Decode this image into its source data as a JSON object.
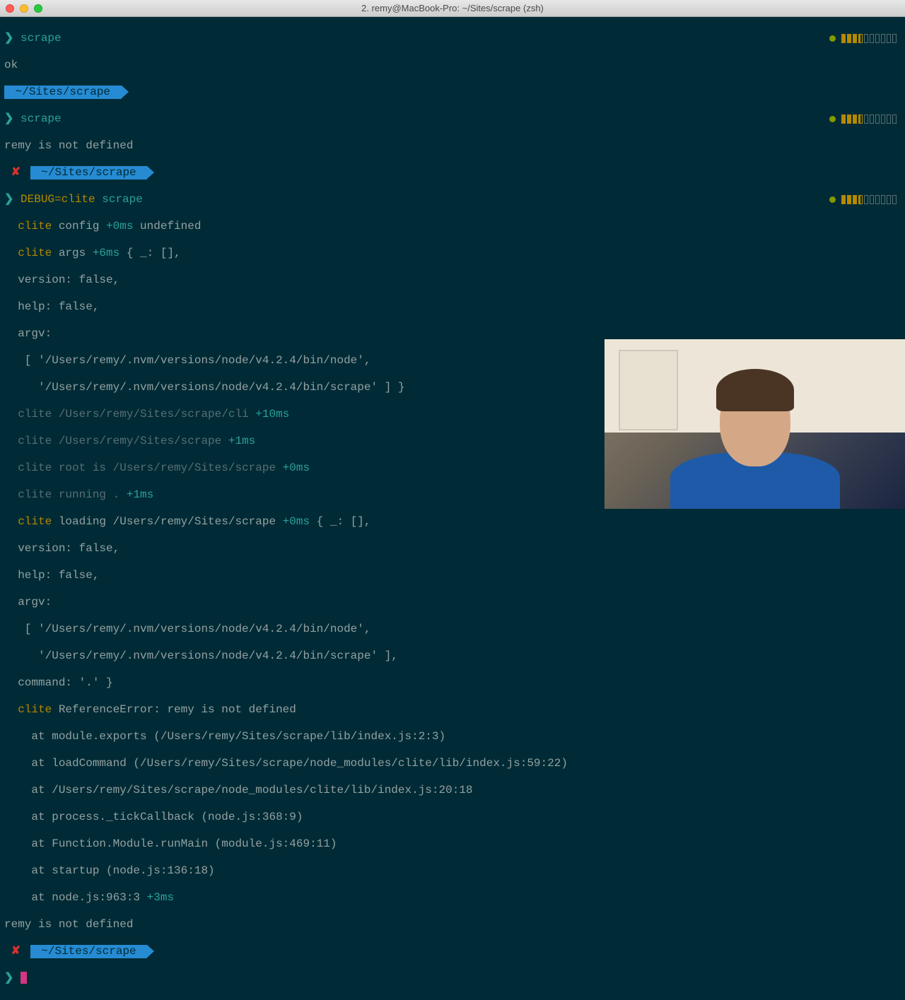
{
  "window": {
    "title": "2. remy@MacBook-Pro: ~/Sites/scrape (zsh)"
  },
  "path": "~/Sites/scrape",
  "prompt_sym": "❯",
  "err_mark": "✘",
  "cmds": {
    "c1": "scrape",
    "ok": "ok",
    "c2": "scrape",
    "err_undef": "remy is not defined",
    "c3_pre": "DEBUG=clite ",
    "c3_cmd": "scrape"
  },
  "debug": {
    "l01a": "clite",
    "l01b": " config ",
    "l01t": "+0ms",
    "l01c": " undefined",
    "l02a": "clite",
    "l02b": " args ",
    "l02t": "+6ms",
    "l02c": " { _: [],",
    "l03": "  version: false,",
    "l04": "  help: false,",
    "l05": "  argv:",
    "l06": "   [ '/Users/remy/.nvm/versions/node/v4.2.4/bin/node',",
    "l07": "     '/Users/remy/.nvm/versions/node/v4.2.4/bin/scrape' ] }",
    "l08a": "clite",
    "l08b": " /Users/remy/Sites/scrape/cli ",
    "l08t": "+10ms",
    "l09a": "clite",
    "l09b": " /Users/remy/Sites/scrape ",
    "l09t": "+1ms",
    "l10a": "clite",
    "l10b": " root is /Users/remy/Sites/scrape ",
    "l10t": "+0ms",
    "l11a": "clite",
    "l11b": " running . ",
    "l11t": "+1ms",
    "l12a": "clite",
    "l12b": " loading /Users/remy/Sites/scrape ",
    "l12t": "+0ms",
    "l12c": " { _: [],",
    "l13": "  version: false,",
    "l14": "  help: false,",
    "l15": "  argv:",
    "l16": "   [ '/Users/remy/.nvm/versions/node/v4.2.4/bin/node',",
    "l17": "     '/Users/remy/.nvm/versions/node/v4.2.4/bin/scrape' ],",
    "l18": "  command: '.' }",
    "l19a": "clite",
    "l19b": " ReferenceError: remy is not defined",
    "l20": "    at module.exports (/Users/remy/Sites/scrape/lib/index.js:2:3)",
    "l21": "    at loadCommand (/Users/remy/Sites/scrape/node_modules/clite/lib/index.js:59:22)",
    "l22": "    at /Users/remy/Sites/scrape/node_modules/clite/lib/index.js:20:18",
    "l23": "    at process._tickCallback (node.js:368:9)",
    "l24": "    at Function.Module.runMain (module.js:469:11)",
    "l25": "    at startup (node.js:136:18)",
    "l26a": "    at node.js:963:3 ",
    "l26t": "+3ms",
    "l27": "remy is not defined"
  }
}
